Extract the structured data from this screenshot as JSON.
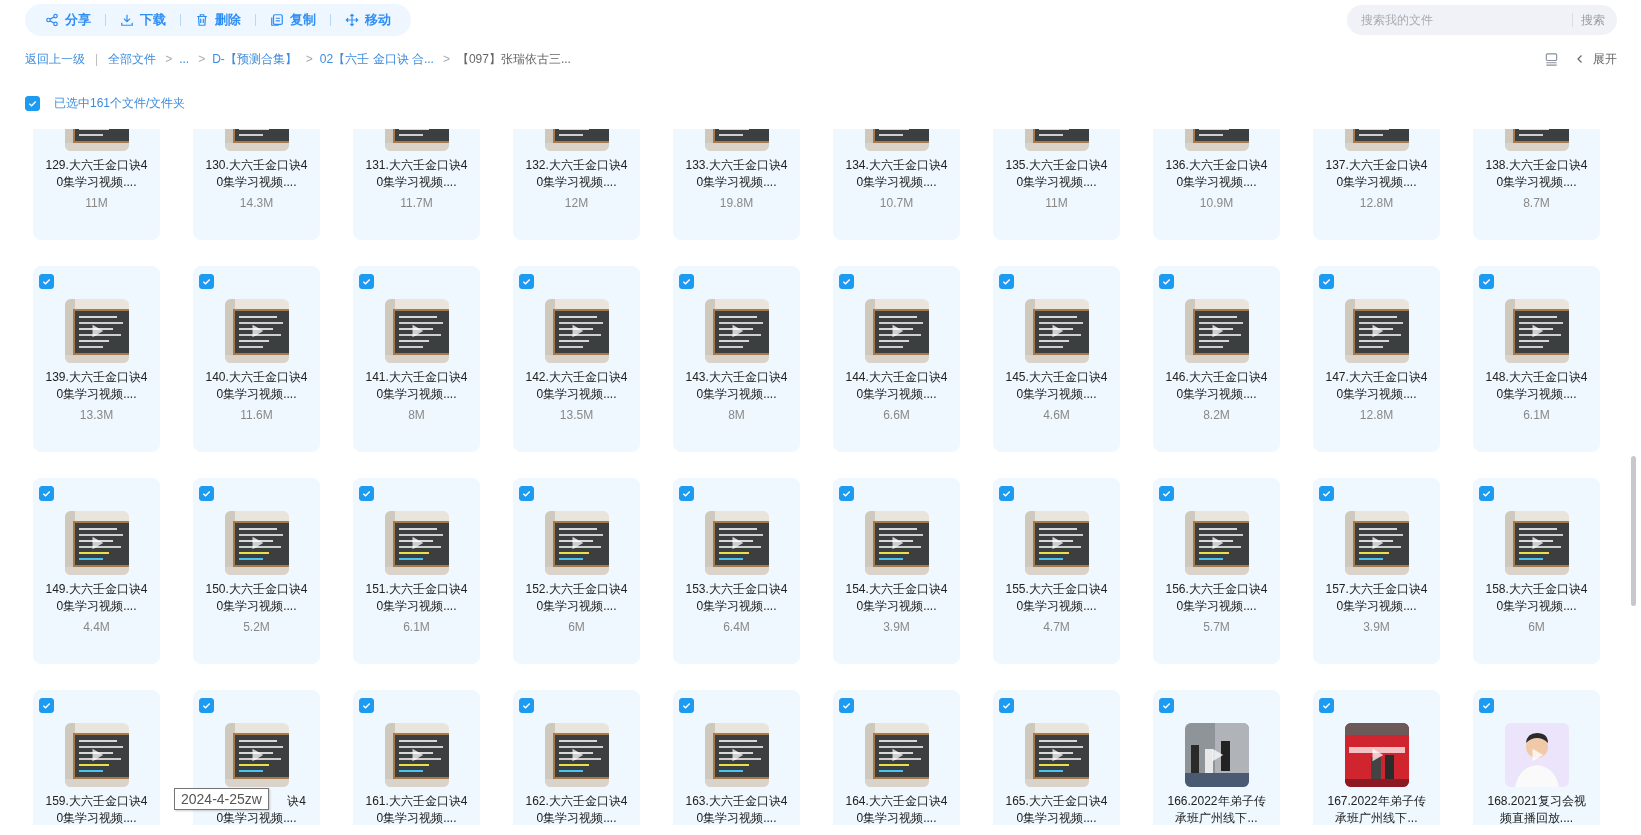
{
  "toolbar": [
    {
      "kind": "share",
      "label": "分享"
    },
    {
      "kind": "download",
      "label": "下载"
    },
    {
      "kind": "delete",
      "label": "删除"
    },
    {
      "kind": "copy",
      "label": "复制"
    },
    {
      "kind": "move",
      "label": "移动"
    }
  ],
  "search": {
    "placeholder": "搜索我的文件",
    "button": "搜索"
  },
  "breadcrumb": {
    "back": "返回上一级",
    "divider": "|",
    "separator": ">",
    "items": [
      {
        "label": "全部文件",
        "current": false
      },
      {
        "label": "...",
        "current": false
      },
      {
        "label": "D-【预测合集】",
        "current": false
      },
      {
        "label": "02【六壬 金口诀 合...",
        "current": false
      },
      {
        "label": "【097】张瑞依古三...",
        "current": true
      }
    ]
  },
  "view_toggle": {
    "expand": "展开"
  },
  "selection": {
    "checked": true,
    "label": "已选中161个文件/文件夹"
  },
  "tooltip": "2024-4-25zw",
  "cards": [
    {
      "lines": [
        "129.大六壬金口诀4",
        "0集学习视频...."
      ],
      "size": "11M",
      "selected": true
    },
    {
      "lines": [
        "130.大六壬金口诀4",
        "0集学习视频...."
      ],
      "size": "14.3M",
      "selected": true
    },
    {
      "lines": [
        "131.大六壬金口诀4",
        "0集学习视频...."
      ],
      "size": "11.7M",
      "selected": true
    },
    {
      "lines": [
        "132.大六壬金口诀4",
        "0集学习视频...."
      ],
      "size": "12M",
      "selected": true
    },
    {
      "lines": [
        "133.大六壬金口诀4",
        "0集学习视频...."
      ],
      "size": "19.8M",
      "selected": true
    },
    {
      "lines": [
        "134.大六壬金口诀4",
        "0集学习视频...."
      ],
      "size": "10.7M",
      "selected": true
    },
    {
      "lines": [
        "135.大六壬金口诀4",
        "0集学习视频...."
      ],
      "size": "11M",
      "selected": true
    },
    {
      "lines": [
        "136.大六壬金口诀4",
        "0集学习视频...."
      ],
      "size": "10.9M",
      "selected": true
    },
    {
      "lines": [
        "137.大六壬金口诀4",
        "0集学习视频...."
      ],
      "size": "12.8M",
      "selected": true
    },
    {
      "lines": [
        "138.大六壬金口诀4",
        "0集学习视频...."
      ],
      "size": "8.7M",
      "selected": true
    },
    {
      "lines": [
        "139.大六壬金口诀4",
        "0集学习视频...."
      ],
      "size": "13.3M",
      "selected": true
    },
    {
      "lines": [
        "140.大六壬金口诀4",
        "0集学习视频...."
      ],
      "size": "11.6M",
      "selected": true
    },
    {
      "lines": [
        "141.大六壬金口诀4",
        "0集学习视频...."
      ],
      "size": "8M",
      "selected": true
    },
    {
      "lines": [
        "142.大六壬金口诀4",
        "0集学习视频...."
      ],
      "size": "13.5M",
      "selected": true
    },
    {
      "lines": [
        "143.大六壬金口诀4",
        "0集学习视频...."
      ],
      "size": "8M",
      "selected": true
    },
    {
      "lines": [
        "144.大六壬金口诀4",
        "0集学习视频...."
      ],
      "size": "6.6M",
      "selected": true
    },
    {
      "lines": [
        "145.大六壬金口诀4",
        "0集学习视频...."
      ],
      "size": "4.6M",
      "selected": true
    },
    {
      "lines": [
        "146.大六壬金口诀4",
        "0集学习视频...."
      ],
      "size": "8.2M",
      "selected": true
    },
    {
      "lines": [
        "147.大六壬金口诀4",
        "0集学习视频...."
      ],
      "size": "12.8M",
      "selected": true
    },
    {
      "lines": [
        "148.大六壬金口诀4",
        "0集学习视频...."
      ],
      "size": "6.1M",
      "selected": true
    },
    {
      "lines": [
        "149.大六壬金口诀4",
        "0集学习视频...."
      ],
      "size": "4.4M",
      "selected": true
    },
    {
      "lines": [
        "150.大六壬金口诀4",
        "0集学习视频...."
      ],
      "size": "5.2M",
      "selected": true
    },
    {
      "lines": [
        "151.大六壬金口诀4",
        "0集学习视频...."
      ],
      "size": "6.1M",
      "selected": true
    },
    {
      "lines": [
        "152.大六壬金口诀4",
        "0集学习视频...."
      ],
      "size": "6M",
      "selected": true
    },
    {
      "lines": [
        "153.大六壬金口诀4",
        "0集学习视频...."
      ],
      "size": "6.4M",
      "selected": true
    },
    {
      "lines": [
        "154.大六壬金口诀4",
        "0集学习视频...."
      ],
      "size": "3.9M",
      "selected": true
    },
    {
      "lines": [
        "155.大六壬金口诀4",
        "0集学习视频...."
      ],
      "size": "4.7M",
      "selected": true
    },
    {
      "lines": [
        "156.大六壬金口诀4",
        "0集学习视频...."
      ],
      "size": "5.7M",
      "selected": true
    },
    {
      "lines": [
        "157.大六壬金口诀4",
        "0集学习视频...."
      ],
      "size": "3.9M",
      "selected": true
    },
    {
      "lines": [
        "158.大六壬金口诀4",
        "0集学习视频...."
      ],
      "size": "6M",
      "selected": true
    },
    {
      "lines": [
        "159.大六壬金口诀4",
        "0集学习视频...."
      ],
      "selected": true
    },
    {
      "lines": [
        "诀4",
        "0集学习视频...."
      ],
      "covered": true,
      "selected": true
    },
    {
      "lines": [
        "161.大六壬金口诀4",
        "0集学习视频...."
      ],
      "selected": true
    },
    {
      "lines": [
        "162.大六壬金口诀4",
        "0集学习视频...."
      ],
      "selected": true
    },
    {
      "lines": [
        "163.大六壬金口诀4",
        "0集学习视频...."
      ],
      "selected": true
    },
    {
      "lines": [
        "164.大六壬金口诀4",
        "0集学习视频...."
      ],
      "selected": true
    },
    {
      "lines": [
        "165.大六壬金口诀4",
        "0集学习视频...."
      ],
      "selected": true
    },
    {
      "lines": [
        "166.2022年弟子传",
        "承班广州线下..."
      ],
      "selected": true
    },
    {
      "lines": [
        "167.2022年弟子传",
        "承班广州线下..."
      ],
      "selected": true
    },
    {
      "lines": [
        "168.2021复习会视",
        "频直播回放...."
      ],
      "selected": true
    }
  ]
}
